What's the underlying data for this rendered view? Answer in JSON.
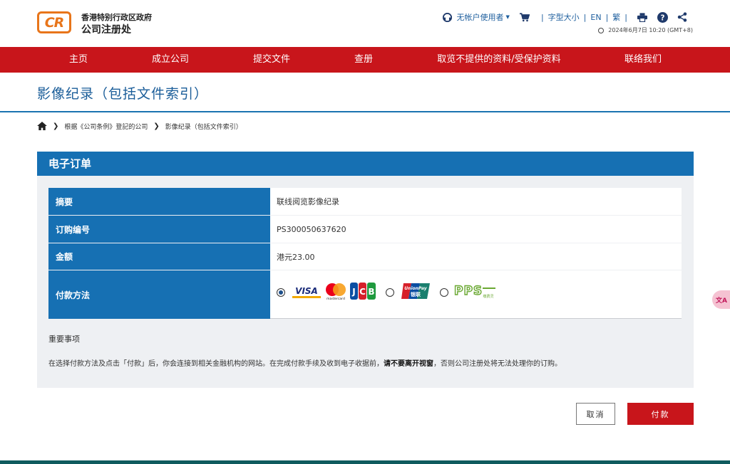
{
  "header": {
    "logo_text": "CR",
    "org_line1": "香港特别行政区政府",
    "org_line2": "公司注册处",
    "user_label": "无帐户使用者",
    "font_size_label": "字型大小",
    "lang_en": "EN",
    "lang_tc": "繁",
    "timestamp": "2024年6月7日 10:20 (GMT+8)",
    "icons": [
      "user-icon",
      "cart-icon",
      "print-icon",
      "help-icon",
      "share-icon",
      "clock-icon"
    ]
  },
  "nav": {
    "items": [
      {
        "label": "主页"
      },
      {
        "label": "成立公司"
      },
      {
        "label": "提交文件"
      },
      {
        "label": "查册"
      },
      {
        "label": "取览不提供的资料/受保护资料"
      },
      {
        "label": "联络我们"
      }
    ]
  },
  "page": {
    "title": "影像纪录（包括文件索引）"
  },
  "breadcrumb": {
    "items": [
      "根据《公司条例》登記的公司",
      "影像纪录（包括文件索引）"
    ]
  },
  "order": {
    "heading": "电子订单",
    "rows": [
      {
        "label": "摘要",
        "value": "联线阅览影像纪录"
      },
      {
        "label": "订购编号",
        "value": "PS300050637620"
      },
      {
        "label": "金额",
        "value": "港元23.00"
      },
      {
        "label": "付款方法",
        "value": ""
      }
    ],
    "payment_methods": [
      {
        "name": "visa-mastercard-jcb",
        "selected": true,
        "logos": [
          "VISA",
          "mastercard",
          "JCB"
        ]
      },
      {
        "name": "unionpay",
        "selected": false,
        "logos": [
          "UnionPay 银联"
        ]
      },
      {
        "name": "pps",
        "selected": false,
        "logos": [
          "PPS 缴费灵"
        ]
      }
    ],
    "notes_title": "重要事项",
    "notes_text_pre": "在选择付款方法及点击「付款」后，你会连接到相关金融机构的网站。在完成付款手续及收到电子收据前，",
    "notes_text_bold": "请不要离开视窗",
    "notes_text_post": "，否则公司注册处将无法处理你的订购。"
  },
  "buttons": {
    "cancel": "取消",
    "pay": "付款"
  },
  "float_tab": {
    "label": "文A"
  },
  "colors": {
    "brand_red": "#c8151b",
    "brand_blue": "#1670b3",
    "logo_orange": "#e8751a"
  }
}
